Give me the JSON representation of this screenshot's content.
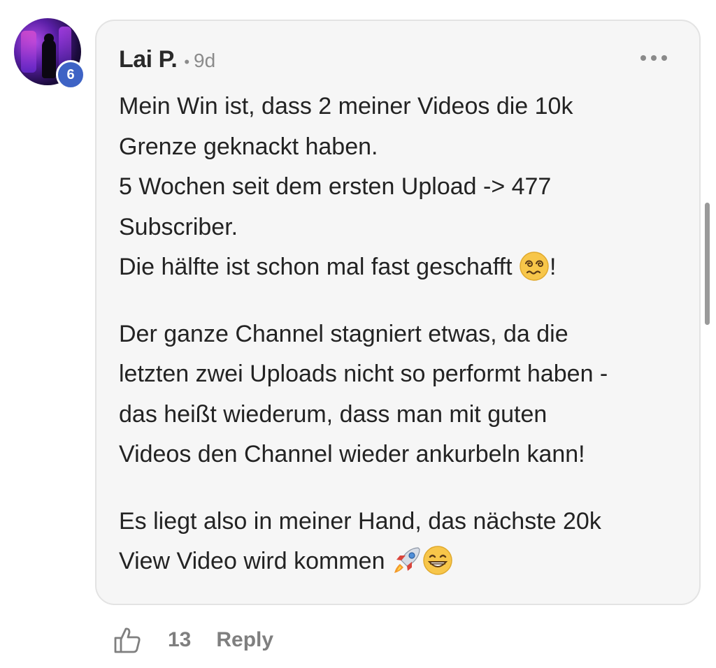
{
  "comment": {
    "author": "Lai P.",
    "separator": "•",
    "time": "9d",
    "level_badge": "6",
    "paragraphs": [
      {
        "lines": [
          "Mein Win ist, dass 2 meiner Videos die 10k",
          "Grenze geknackt haben.",
          "5 Wochen seit dem ersten Upload -> 477",
          "Subscriber."
        ],
        "last_line_before_emoji": "Die hälfte ist schon mal fast geschafft ",
        "last_line_emoji": "woozy-face-emoji",
        "last_line_after_emoji": "!"
      },
      {
        "lines": [
          "Der ganze Channel stagniert etwas, da die",
          "letzten zwei Uploads nicht so performt haben -",
          "das heißt wiederum, dass man mit guten",
          "Videos den Channel wieder ankurbeln kann!"
        ]
      },
      {
        "lines": [
          "Es liegt also in meiner Hand, das nächste 20k"
        ],
        "last_line_before_emoji": "View Video wird kommen ",
        "last_line_emojis": [
          "rocket-emoji",
          "grinning-face-emoji"
        ]
      }
    ],
    "like_count": "13",
    "reply_label": "Reply",
    "icons": {
      "more": "more-horizontal-icon",
      "like": "thumbs-up-icon"
    }
  }
}
